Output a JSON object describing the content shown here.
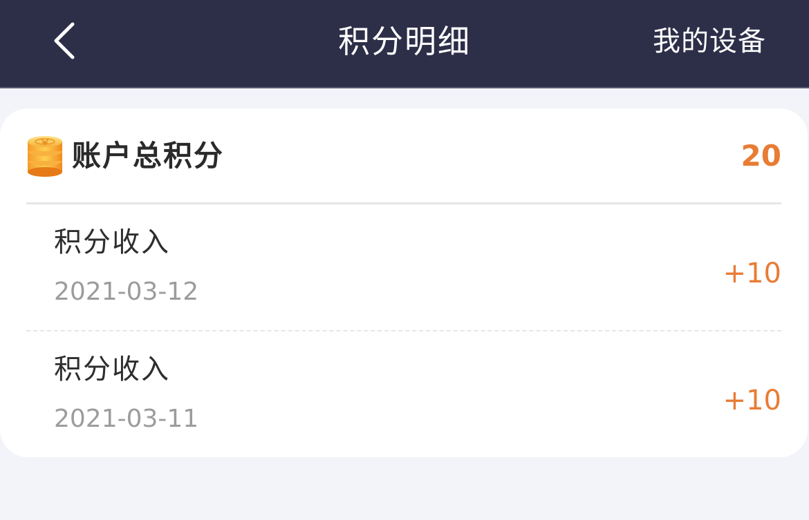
{
  "navbar": {
    "title": "积分明细",
    "right_action": "我的设备",
    "back_icon": "chevron-left-icon"
  },
  "summary": {
    "icon": "coin-stack-icon",
    "label": "账户总积分",
    "value": "20"
  },
  "records": [
    {
      "title": "积分收入",
      "date": "2021-03-12",
      "amount": "+10"
    },
    {
      "title": "积分收入",
      "date": "2021-03-11",
      "amount": "+10"
    }
  ],
  "colors": {
    "navbar_bg": "#2d2e48",
    "accent": "#e87c34",
    "page_bg": "#f3f4f9"
  }
}
